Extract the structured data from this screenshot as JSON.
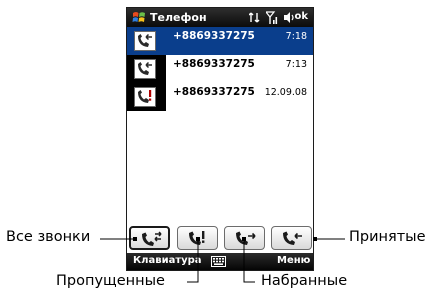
{
  "title_bar": {
    "app_title": "Телефон",
    "ok_label": "ok",
    "icons": [
      "windows-flag-icon",
      "connectivity-icon",
      "signal-icon",
      "speaker-icon"
    ]
  },
  "calls": [
    {
      "type": "received",
      "icon": "received-call-icon",
      "number": "+8869337275",
      "time": "7:18",
      "selected": true
    },
    {
      "type": "received",
      "icon": "received-call-icon",
      "number": "+8869337275",
      "time": "7:13",
      "selected": false
    },
    {
      "type": "missed",
      "icon": "missed-call-icon",
      "number": "+8869337275",
      "time": "12.09.08",
      "selected": false
    }
  ],
  "filter_tabs": [
    {
      "icon": "all-calls-icon",
      "active": true
    },
    {
      "icon": "missed-call-icon",
      "active": false
    },
    {
      "icon": "dialed-call-icon",
      "active": false
    },
    {
      "icon": "received-call-icon",
      "active": false
    }
  ],
  "softkeys": {
    "left_label": "Клавиатура",
    "center_icon": "keyboard-icon",
    "right_label": "Меню"
  },
  "callouts": {
    "all_calls": "Все звонки",
    "missed": "Пропущенные",
    "dialed": "Набранные",
    "received": "Принятые"
  },
  "colors": {
    "selection": "#0a3e8c",
    "title_bar": "#1a1a1a",
    "missed_accent": "#b00000"
  }
}
